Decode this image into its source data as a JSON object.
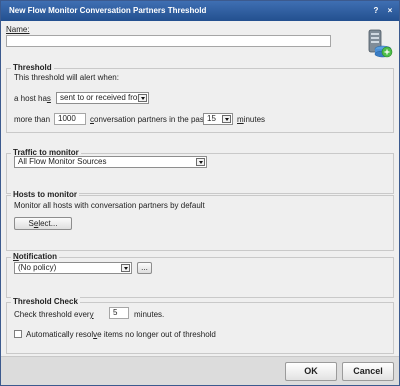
{
  "window": {
    "title": "New Flow Monitor Conversation Partners Threshold",
    "help_glyph": "?",
    "close_glyph": "×"
  },
  "name": {
    "label": "Name:",
    "value": ""
  },
  "threshold": {
    "legend": "Threshold",
    "description": "This threshold will alert when:",
    "host_label_pre": "a host ha",
    "host_label_u": "s",
    "direction_value": "sent to or received from",
    "more_than_label": "more than",
    "count_value": "1000",
    "partners_label_u": "c",
    "partners_label_post": "onversation partners in the past",
    "duration_value": "15",
    "minutes_label_u": "m",
    "minutes_label_post": "inutes"
  },
  "traffic": {
    "legend": "Traffic to monitor",
    "source_value": "All Flow Monitor Sources"
  },
  "hosts": {
    "legend": "Hosts to monitor",
    "description": "Monitor all hosts with conversation partners by default",
    "select_label_pre": "S",
    "select_label_u": "e",
    "select_label_post": "lect..."
  },
  "notification": {
    "legend_u": "N",
    "legend_post": "otification",
    "policy_value": "(No policy)",
    "browse_label": "..."
  },
  "check": {
    "legend": "Threshold Check",
    "label_pre": "Check threshold ever",
    "label_u": "y",
    "interval_value": "5",
    "minutes_label": "minutes.",
    "auto_resolve_pre": "Automatically resol",
    "auto_resolve_u": "v",
    "auto_resolve_post": "e items no longer out of threshold",
    "auto_resolve_checked": false
  },
  "footer": {
    "ok_label": "OK",
    "cancel_label": "Cancel"
  },
  "icons": {
    "header_icon": "server-network-icon"
  }
}
